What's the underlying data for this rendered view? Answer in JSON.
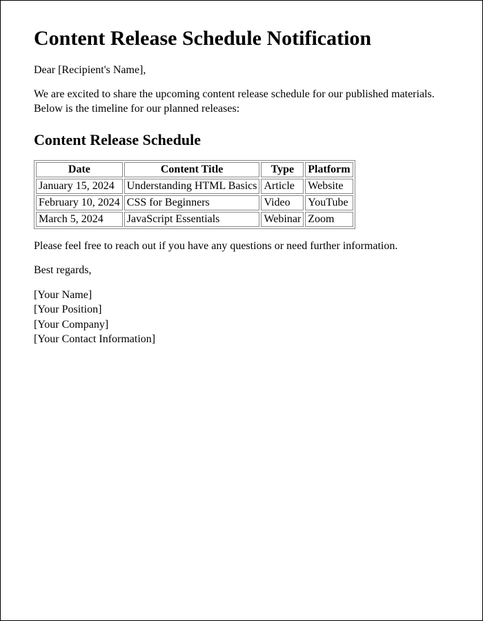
{
  "title": "Content Release Schedule Notification",
  "salutation": "Dear [Recipient's Name],",
  "intro": "We are excited to share the upcoming content release schedule for our published materials. Below is the timeline for our planned releases:",
  "schedule": {
    "heading": "Content Release Schedule",
    "headers": {
      "date": "Date",
      "title": "Content Title",
      "type": "Type",
      "platform": "Platform"
    },
    "rows": [
      {
        "date": "January 15, 2024",
        "title": "Understanding HTML Basics",
        "type": "Article",
        "platform": "Website"
      },
      {
        "date": "February 10, 2024",
        "title": "CSS for Beginners",
        "type": "Video",
        "platform": "YouTube"
      },
      {
        "date": "March 5, 2024",
        "title": "JavaScript Essentials",
        "type": "Webinar",
        "platform": "Zoom"
      }
    ]
  },
  "closing_note": "Please feel free to reach out if you have any questions or need further information.",
  "valediction": "Best regards,",
  "signature": {
    "name": "[Your Name]",
    "position": "[Your Position]",
    "company": "[Your Company]",
    "contact": "[Your Contact Information]"
  }
}
